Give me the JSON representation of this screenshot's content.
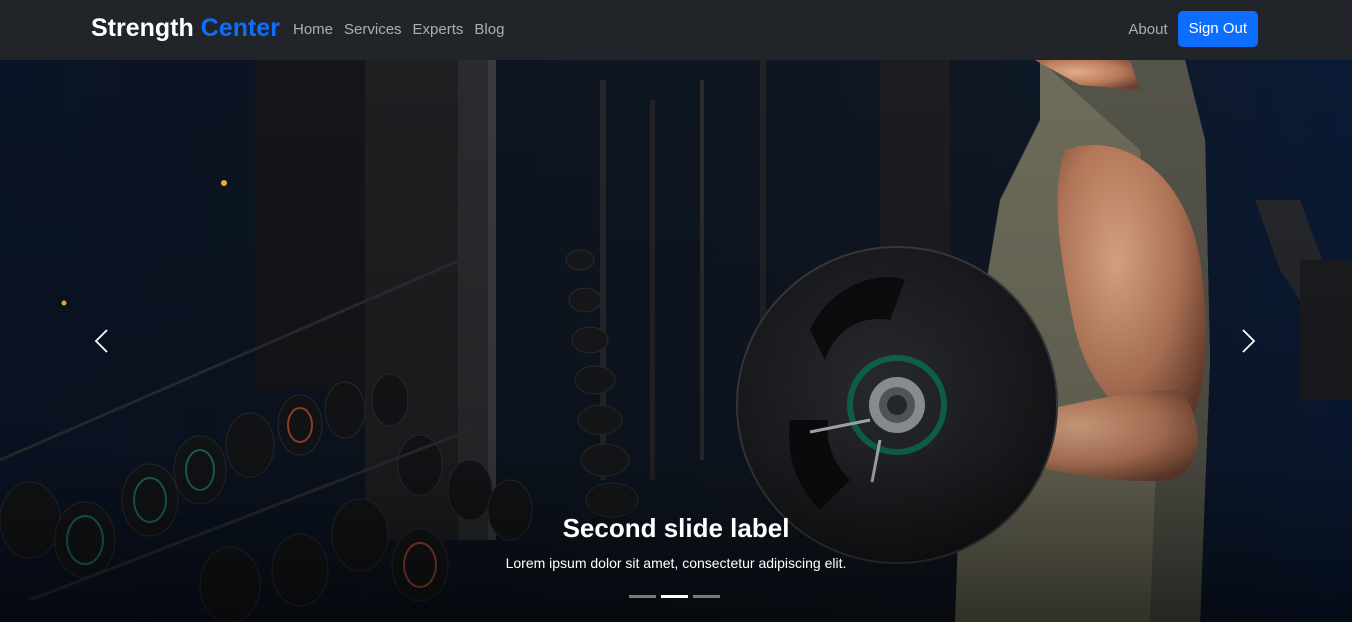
{
  "brand": {
    "part1": "Strength",
    "part2": "Center"
  },
  "nav": {
    "links": [
      {
        "label": "Home"
      },
      {
        "label": "Services"
      },
      {
        "label": "Experts"
      },
      {
        "label": "Blog"
      }
    ],
    "about_label": "About",
    "signout_label": "Sign Out"
  },
  "carousel": {
    "caption_title": "Second slide label",
    "caption_text": "Lorem ipsum dolor sit amet, consectetur adipiscing elit.",
    "slide_count": 3,
    "active_index": 1,
    "prev_icon": "chevron-left-icon",
    "next_icon": "chevron-right-icon"
  },
  "colors": {
    "navbar_bg": "#212529",
    "brand_accent": "#0d6efd",
    "button_bg": "#0d6efd"
  }
}
